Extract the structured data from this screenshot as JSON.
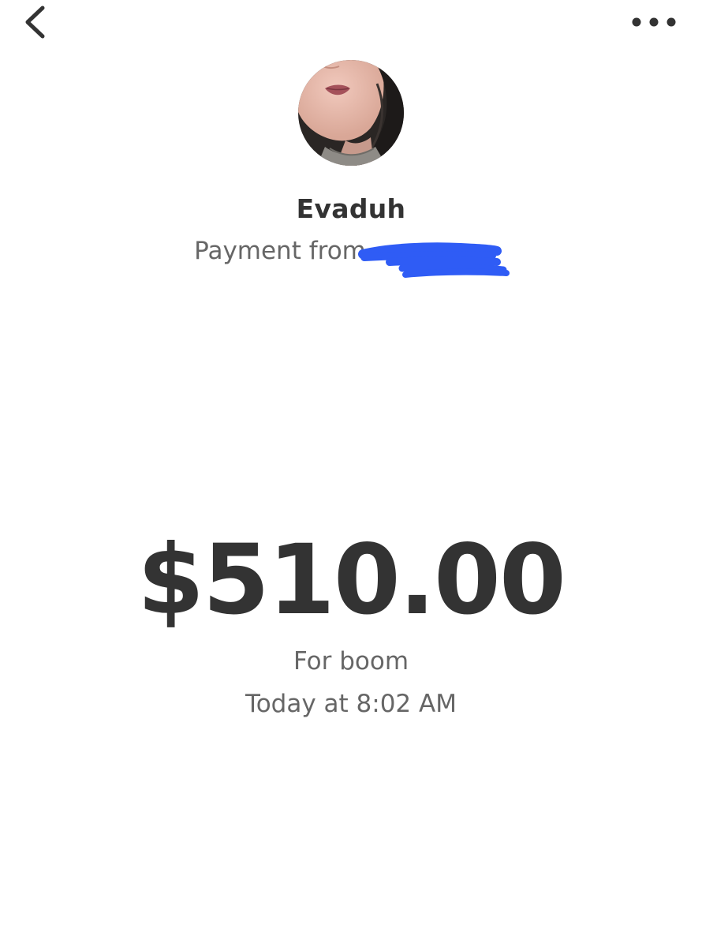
{
  "header": {
    "back_icon": "chevron-left-icon",
    "more_icon": "more-horizontal-icon"
  },
  "payer": {
    "name": "Evaduh",
    "subtitle": "Payment from"
  },
  "payment": {
    "amount": "$510.00",
    "note": "For boom",
    "timestamp": "Today at 8:02 AM"
  },
  "colors": {
    "text_primary": "#333333",
    "text_secondary": "#666666",
    "redaction": "#2f5cf5",
    "background": "#ffffff"
  }
}
